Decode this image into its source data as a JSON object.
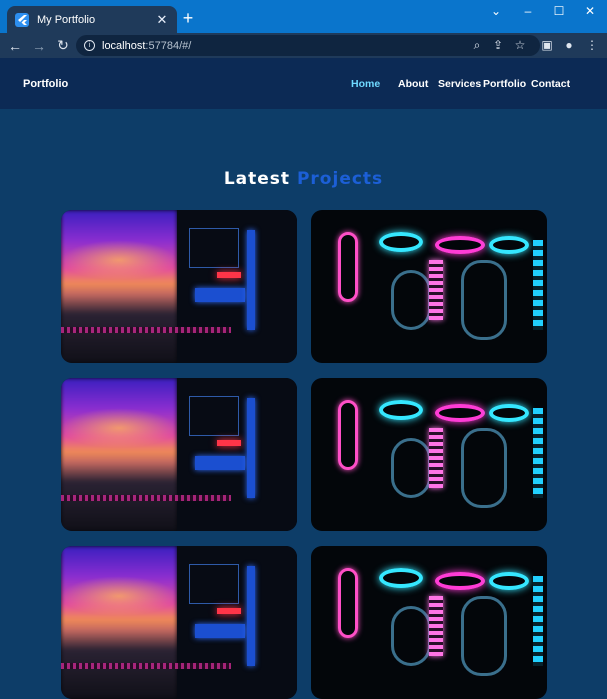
{
  "browser": {
    "tab_title": "My Portfolio",
    "tab_close": "✕",
    "new_tab": "+",
    "url_host": "localhost",
    "url_rest": ":57784/#/",
    "window_controls": [
      "⌄",
      "–",
      "☐",
      "✕"
    ],
    "toolbar_icons": [
      "zoom-icon",
      "share-icon",
      "star-icon",
      "sidebar-icon",
      "profile-icon",
      "menu-icon"
    ]
  },
  "site": {
    "brand": "Portfolio",
    "nav": [
      {
        "label": "Home",
        "active": true
      },
      {
        "label": "About",
        "active": false
      },
      {
        "label": "Services",
        "active": false
      },
      {
        "label": "Portfolio",
        "active": false
      },
      {
        "label": "Contact",
        "active": false
      }
    ],
    "heading_word1": "Latest",
    "heading_word2": "Projects"
  },
  "colors": {
    "nav_bg": "#0c2a55",
    "page_bg": "#0d3d68",
    "active_link": "#6fd9ff",
    "accent_heading": "#1c5fd6"
  },
  "projects": [
    {
      "image": "pc-build-rgb-keyboard"
    },
    {
      "image": "pc-liquid-cooling"
    },
    {
      "image": "pc-build-rgb-keyboard"
    },
    {
      "image": "pc-liquid-cooling"
    },
    {
      "image": "pc-build-rgb-keyboard"
    },
    {
      "image": "pc-liquid-cooling"
    }
  ]
}
